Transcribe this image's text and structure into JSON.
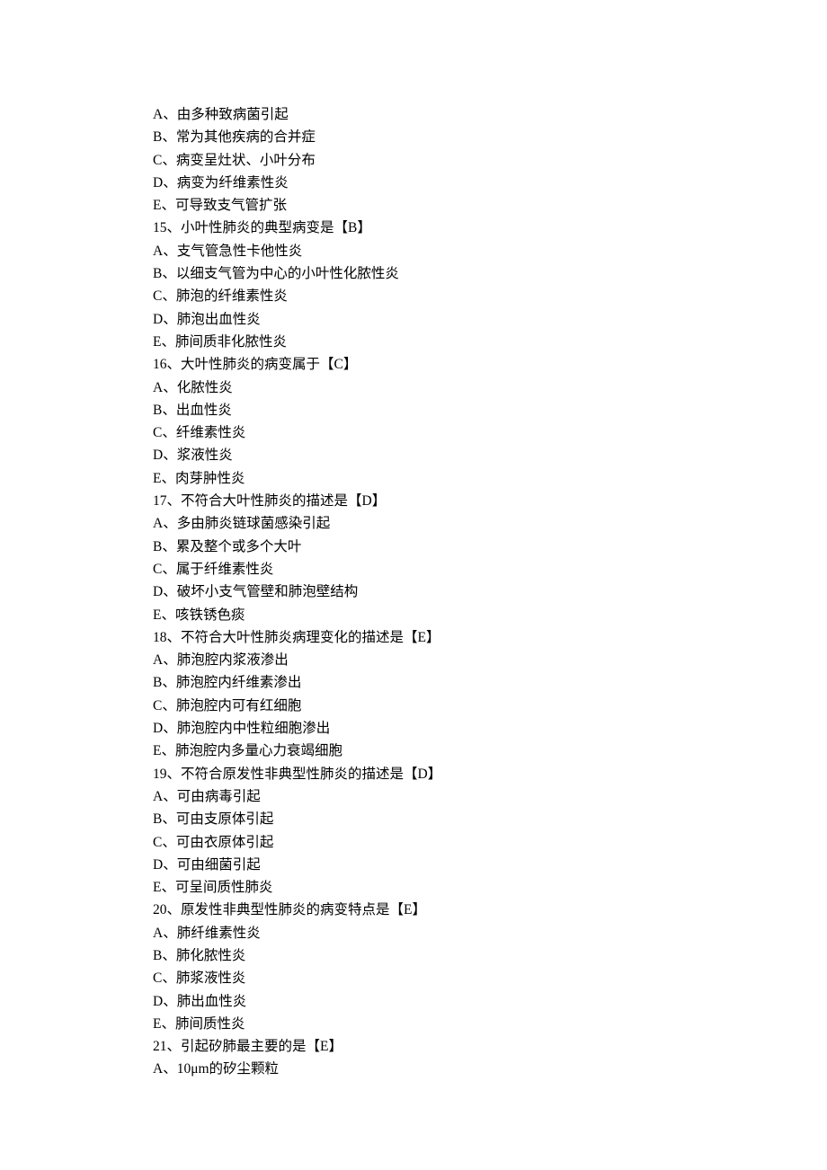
{
  "lines": [
    "A、由多种致病菌引起",
    "B、常为其他疾病的合并症",
    "C、病变呈灶状、小叶分布",
    "D、病变为纤维素性炎",
    "E、可导致支气管扩张",
    "15、小叶性肺炎的典型病变是【B】",
    "A、支气管急性卡他性炎",
    "B、以细支气管为中心的小叶性化脓性炎",
    "C、肺泡的纤维素性炎",
    "D、肺泡出血性炎",
    "E、肺间质非化脓性炎",
    "16、大叶性肺炎的病变属于【C】",
    "A、化脓性炎",
    "B、出血性炎",
    "C、纤维素性炎",
    "D、浆液性炎",
    "E、肉芽肿性炎",
    "17、不符合大叶性肺炎的描述是【D】",
    "A、多由肺炎链球菌感染引起",
    "B、累及整个或多个大叶",
    "C、属于纤维素性炎",
    "D、破坏小支气管壁和肺泡壁结构",
    "E、咳铁锈色痰",
    "18、不符合大叶性肺炎病理变化的描述是【E】",
    "A、肺泡腔内浆液渗出",
    "B、肺泡腔内纤维素渗出",
    "C、肺泡腔内可有红细胞",
    "D、肺泡腔内中性粒细胞渗出",
    "E、肺泡腔内多量心力衰竭细胞",
    "19、不符合原发性非典型性肺炎的描述是【D】",
    "A、可由病毒引起",
    "B、可由支原体引起",
    "C、可由衣原体引起",
    "D、可由细菌引起",
    "E、可呈间质性肺炎",
    "20、原发性非典型性肺炎的病变特点是【E】",
    "A、肺纤维素性炎",
    "B、肺化脓性炎",
    "C、肺浆液性炎",
    "D、肺出血性炎",
    "E、肺间质性炎",
    "21、引起矽肺最主要的是【E】",
    "A、10μm的矽尘颗粒"
  ]
}
